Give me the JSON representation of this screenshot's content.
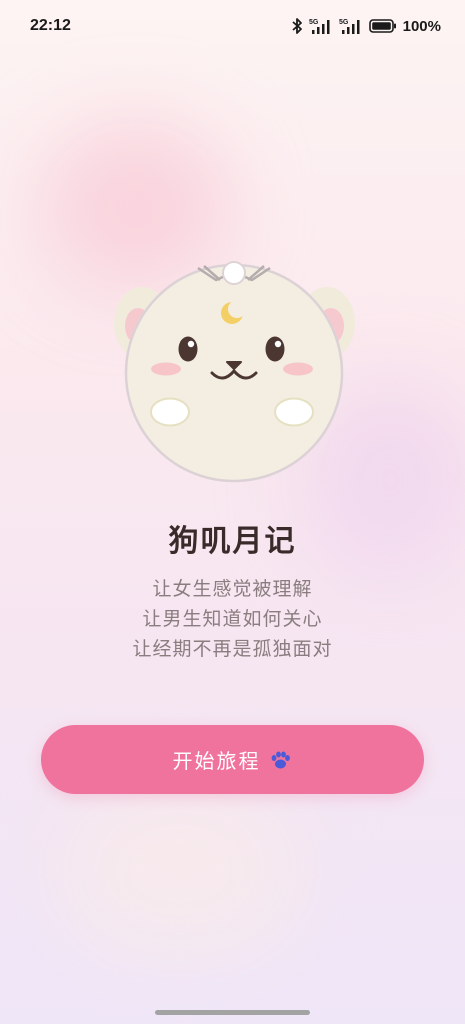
{
  "status_bar": {
    "time": "22:12",
    "network_1": "5G",
    "network_2": "5G",
    "battery": "100%",
    "icons": [
      "bluetooth-icon",
      "signal-5g-icon",
      "signal-5g-icon",
      "battery-icon"
    ]
  },
  "mascot": {
    "icon": "dog-mascot-with-moon-crown"
  },
  "app": {
    "title": "狗叽月记",
    "taglines": [
      "让女生感觉被理解",
      "让男生知道如何关心",
      "让经期不再是孤独面对"
    ]
  },
  "start_button": {
    "label": "开始旅程",
    "icon": "paw-icon"
  },
  "colors": {
    "accent": "#f0739e",
    "title": "#3a2b2b",
    "tagline": "#8a7d7f"
  }
}
